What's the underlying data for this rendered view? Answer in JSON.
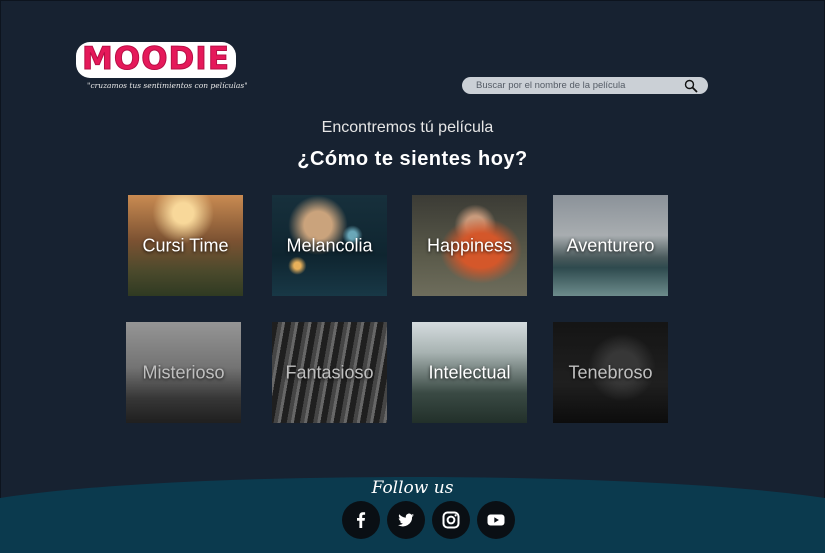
{
  "brand": {
    "name": "MOODIE",
    "tagline": "\"cruzamos tus sentimientos con películas\""
  },
  "search": {
    "placeholder": "Buscar por el nombre de la película",
    "icon": "search-icon"
  },
  "intro": "Encontremos tú película",
  "question": "¿Cómo te sientes hoy?",
  "moods": [
    {
      "label": "Cursi Time"
    },
    {
      "label": "Melancolia"
    },
    {
      "label": "Happiness"
    },
    {
      "label": "Aventurero"
    },
    {
      "label": "Misterioso"
    },
    {
      "label": "Fantasioso"
    },
    {
      "label": "Intelectual"
    },
    {
      "label": "Tenebroso"
    }
  ],
  "footer": {
    "follow": "Follow us",
    "social": [
      {
        "icon": "facebook-icon"
      },
      {
        "icon": "twitter-icon"
      },
      {
        "icon": "instagram-icon"
      },
      {
        "icon": "youtube-icon"
      }
    ]
  },
  "colors": {
    "background": "#172231",
    "footer": "#0b3a4e",
    "brand": "#e5195a"
  }
}
